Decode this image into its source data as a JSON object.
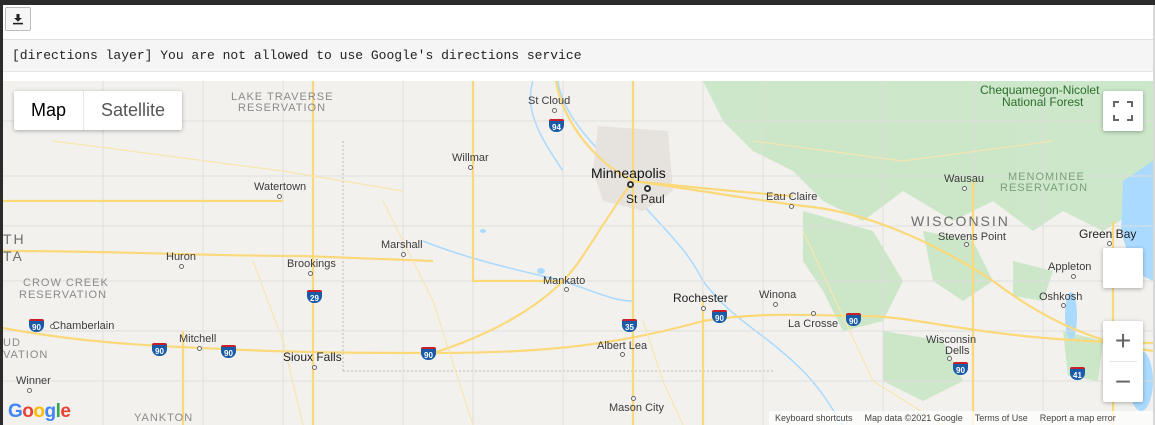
{
  "toolbar": {
    "download_icon": "download-icon"
  },
  "output": {
    "message": "[directions layer] You are not allowed to use Google's directions service"
  },
  "map": {
    "type_control": {
      "map_label": "Map",
      "satellite_label": "Satellite"
    },
    "zoom": {
      "in_label": "+",
      "out_label": "−"
    },
    "logo": [
      "G",
      "o",
      "o",
      "g",
      "l",
      "e"
    ],
    "footer": {
      "shortcuts": "Keyboard shortcuts",
      "map_data": "Map data ©2021 Google",
      "terms": "Terms of Use",
      "report": "Report a map error"
    },
    "labels": {
      "st_cloud": "St Cloud",
      "minneapolis": "Minneapolis",
      "st_paul": "St Paul",
      "willmar": "Willmar",
      "watertown": "Watertown",
      "marshall": "Marshall",
      "huron": "Huron",
      "brookings": "Brookings",
      "mankato": "Mankato",
      "rochester": "Rochester",
      "winona": "Winona",
      "la_crosse": "La Crosse",
      "albert_lea": "Albert Lea",
      "mason_city": "Mason City",
      "sioux_falls": "Sioux Falls",
      "mitchell": "Mitchell",
      "chamberlain": "Chamberlain",
      "winner": "Winner",
      "yankton": "YANKTON",
      "eau_claire": "Eau Claire",
      "wausau": "Wausau",
      "stevens_point": "Stevens Point",
      "green_bay": "Green Bay",
      "appleton": "Appleton",
      "oshkosh": "Oshkosh",
      "wisconsin_dells": "Wisconsin",
      "wisconsin_dells2": "Dells",
      "wisconsin": "WISCONSIN",
      "lake_traverse_1": "LAKE TRAVERSE",
      "lake_traverse_2": "RESERVATION",
      "crow_creek_1": "CROW CREEK",
      "crow_creek_2": "RESERVATION",
      "menominee_1": "MENOMINEE",
      "menominee_2": "RESERVATION",
      "chequamegon_1": "Chequamegon-Nicolet",
      "chequamegon_2": "National Forest",
      "edge_th": "TH",
      "edge_ta": "TA",
      "edge_ud": "UD",
      "edge_vation": "VATION"
    },
    "shields": [
      "94",
      "29",
      "90",
      "90",
      "90",
      "90",
      "35",
      "90",
      "90",
      "90",
      "41"
    ],
    "colors": {
      "land": "#f2f1ee",
      "road": "#fbd97a",
      "water": "#aadaff",
      "forest": "#c5e6c0",
      "shield": "#1a5ba8"
    }
  }
}
